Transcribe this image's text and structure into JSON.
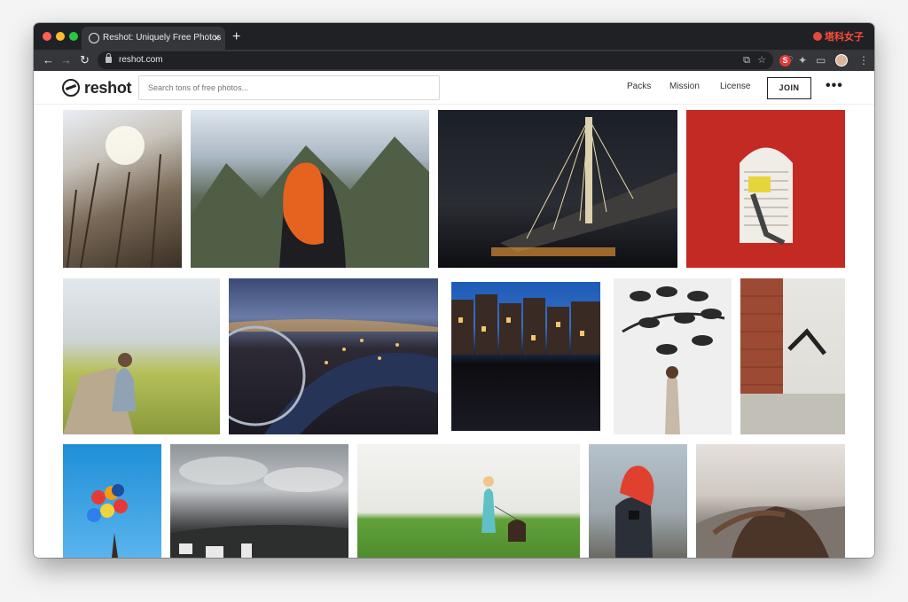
{
  "browser": {
    "tab_title": "Reshot: Uniquely Free Photos",
    "tab_close": "×",
    "new_tab": "+",
    "url": "reshot.com",
    "badge_text": "塔科女子",
    "back": "←",
    "forward": "→",
    "reload": "↻",
    "ext_s_label": "S",
    "menu": "⋮"
  },
  "site": {
    "logo_text": "reshot",
    "search_placeholder": "Search tons of free photos...",
    "nav": [
      "Packs",
      "Mission",
      "License"
    ],
    "join_label": "JOIN",
    "more_label": "•••"
  },
  "colors": {
    "chrome_dark": "#202124",
    "chrome_toolbar": "#35363a",
    "accent_badge": "#ff4b3a"
  },
  "photos": [
    {
      "subject": "reeds-at-sunset"
    },
    {
      "subject": "red-haired-woman-taking-photo-of-mountains"
    },
    {
      "subject": "suspension-bridge-at-night"
    },
    {
      "subject": "man-climbing-window-on-red-wall"
    },
    {
      "subject": "woman-photographing-flowers"
    },
    {
      "subject": "london-eye-city-at-dusk"
    },
    {
      "subject": "amsterdam-canal-houses-at-night"
    },
    {
      "subject": "woman-against-leaf-mural"
    },
    {
      "subject": "man-jumping-off-brick-wall"
    },
    {
      "subject": "colorful-balloons-blue-sky"
    },
    {
      "subject": "cloudy-sky-over-city"
    },
    {
      "subject": "girl-walking-dog-on-grass"
    },
    {
      "subject": "red-haired-woman-on-phone"
    },
    {
      "subject": "wind-blown-hair-mountains"
    }
  ]
}
